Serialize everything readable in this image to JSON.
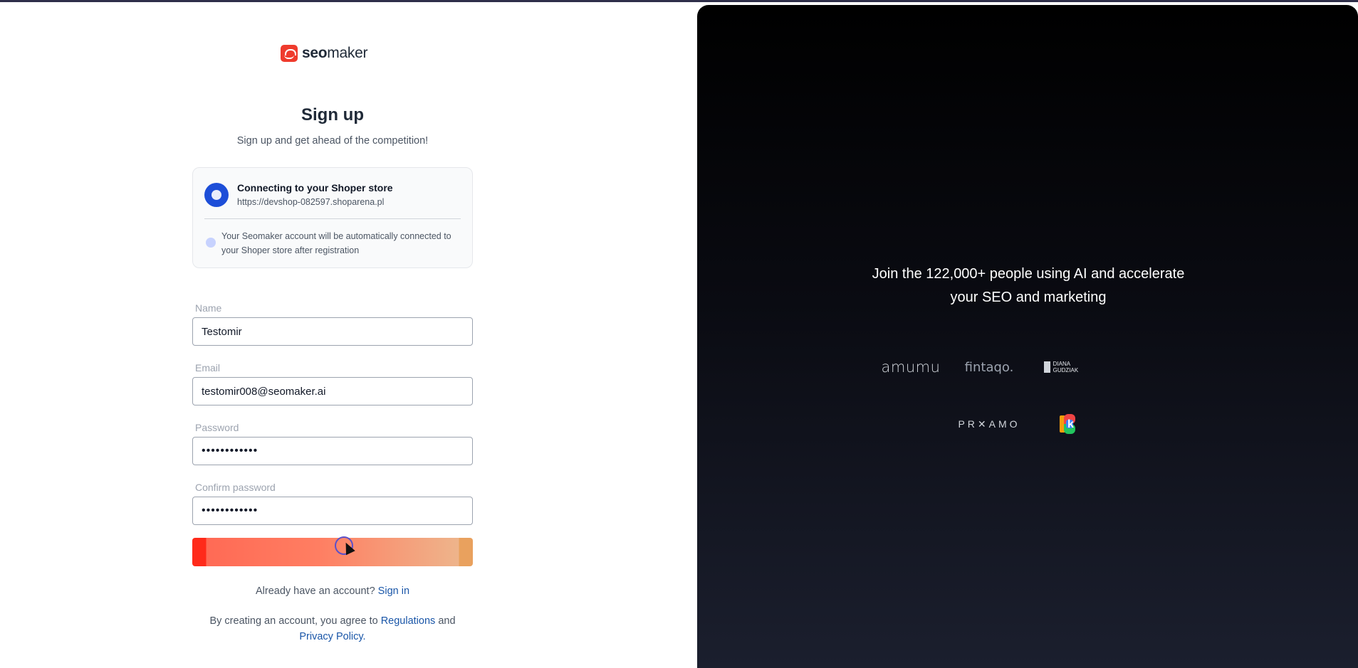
{
  "brand": {
    "name_bold": "seo",
    "name_rest": "maker"
  },
  "heading": {
    "title": "Sign up",
    "subtitle": "Sign up and get ahead of the competition!"
  },
  "connect_card": {
    "title": "Connecting to your Shoper store",
    "url": "https://devshop-082597.shoparena.pl",
    "info": "Your Seomaker account will be automatically connected to your Shoper store after registration"
  },
  "form": {
    "name": {
      "label": "Name",
      "value": "Testomir"
    },
    "email": {
      "label": "Email",
      "value": "testomir008@seomaker.ai"
    },
    "password": {
      "label": "Password",
      "value": "••••••••••••"
    },
    "confirm_password": {
      "label": "Confirm password",
      "value": "••••••••••••"
    }
  },
  "signin": {
    "prompt": "Already have an account?",
    "link": "Sign in"
  },
  "terms": {
    "prefix": "By creating an account, you agree to",
    "regulations": "Regulations",
    "and": "and",
    "privacy": "Privacy Policy."
  },
  "promo": {
    "tagline": "Join the 122,000+ people using AI and accelerate your SEO and marketing",
    "logos": {
      "amumu": "amumu",
      "fintaqo": "fintaqo.",
      "diana": "DIANA GUDZIAK",
      "proxamo": "PR✕AMO",
      "k": "k"
    }
  },
  "colors": {
    "accent": "#ef3b2d",
    "link": "#1a56a8",
    "shoper": "#1d4ed8"
  }
}
